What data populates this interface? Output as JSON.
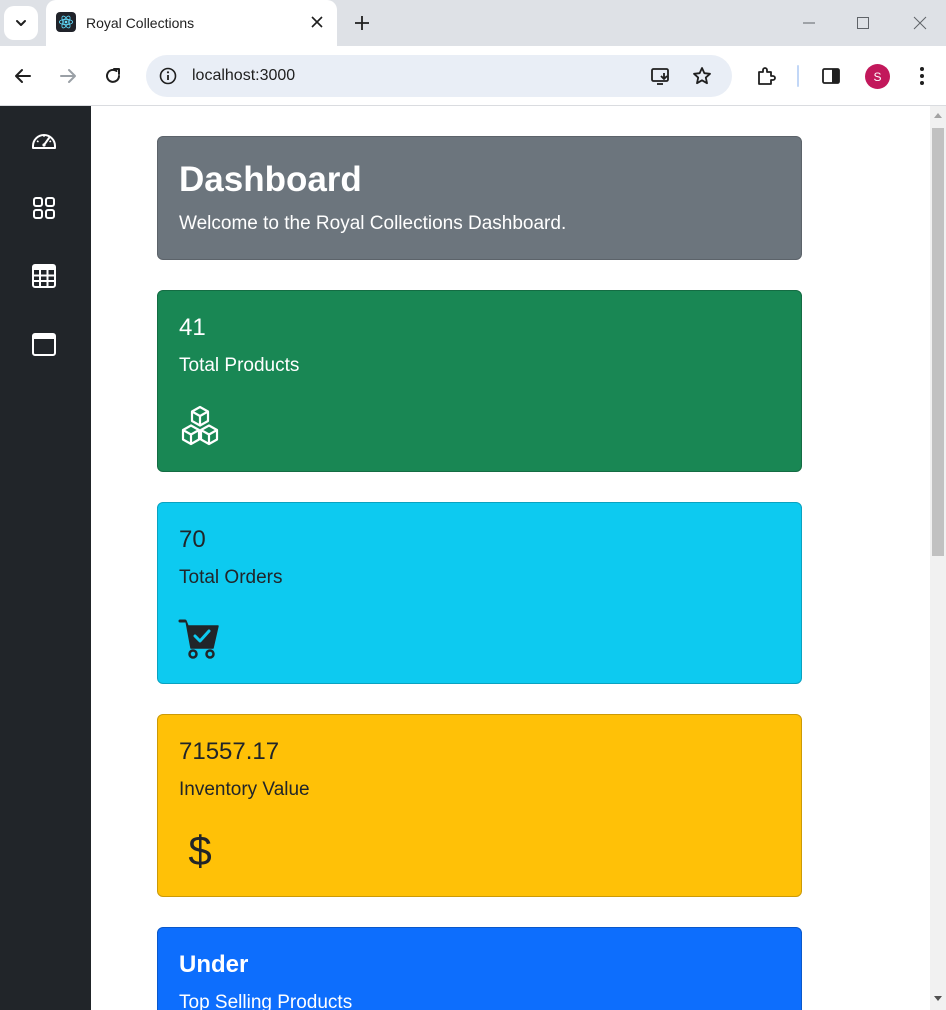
{
  "browser": {
    "tab_title": "Royal Collections",
    "url": "localhost:3000",
    "profile_initial": "S",
    "profile_color": "#c2185b"
  },
  "sidebar": {
    "icons": [
      "speedometer-icon",
      "grid-icon",
      "table-icon",
      "calendar-icon"
    ]
  },
  "header": {
    "title": "Dashboard",
    "subtitle": "Welcome to the Royal Collections Dashboard.",
    "color": "#6c757d"
  },
  "cards": [
    {
      "value": "41",
      "label": "Total Products",
      "icon": "boxes-icon",
      "color": "#198754",
      "text_color": "#ffffff"
    },
    {
      "value": "70",
      "label": "Total Orders",
      "icon": "cart-check-icon",
      "color": "#0dcaf0",
      "text_color": "#212529"
    },
    {
      "value": "71557.17",
      "label": "Inventory Value",
      "icon": "dollar-icon",
      "color": "#ffc107",
      "text_color": "#212529"
    },
    {
      "value": "Under",
      "label": "Top Selling Products",
      "color": "#0d6efd",
      "text_color": "#ffffff"
    }
  ]
}
